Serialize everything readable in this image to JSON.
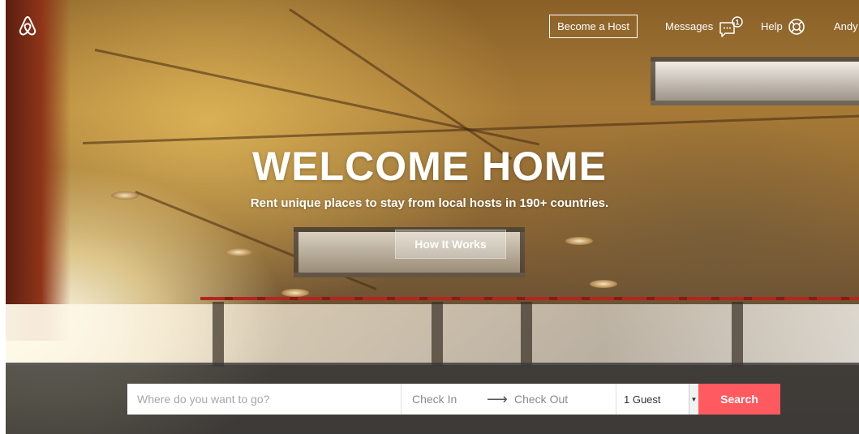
{
  "nav": {
    "logo_icon": "airbnb-belo-logo",
    "become_host": "Become a Host",
    "messages": "Messages",
    "messages_icon": "message-bubble-icon",
    "messages_badge": "1",
    "help": "Help",
    "help_icon": "lifebuoy-icon",
    "user": "Andy"
  },
  "hero": {
    "title": "WELCOME HOME",
    "subtitle": "Rent unique places to stay from local hosts in 190+ countries.",
    "how_it_works": "How It Works"
  },
  "search": {
    "where_placeholder": "Where do you want to go?",
    "check_in": "Check In",
    "arrow": "⟶",
    "check_out": "Check Out",
    "guests_selected": "1 Guest",
    "search_label": "Search"
  },
  "colors": {
    "accent": "#ff5a5f",
    "text_light": "#ffffff",
    "search_band": "#3a3a3a"
  }
}
